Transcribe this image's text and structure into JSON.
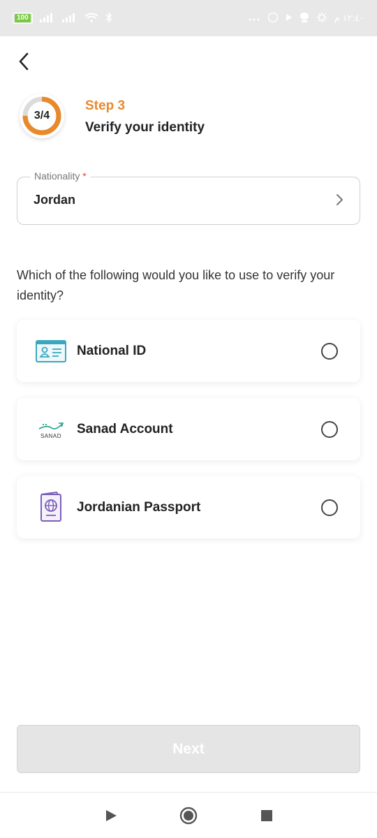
{
  "status_bar": {
    "battery": "100",
    "time": "١٢:٤٠ م"
  },
  "step": {
    "ring_text": "3/4",
    "progress": 0.75,
    "label": "Step 3",
    "title": "Verify your identity",
    "accent_color": "#e8892c"
  },
  "nationality": {
    "label": "Nationality",
    "required_mark": "*",
    "value": "Jordan"
  },
  "question": "Which of the following would you like to use to verify your identity?",
  "options": [
    {
      "label": "National ID",
      "icon": "id-card-icon",
      "selected": false
    },
    {
      "label": "Sanad Account",
      "icon": "sanad-logo",
      "logo_text": "SANAD",
      "selected": false
    },
    {
      "label": "Jordanian Passport",
      "icon": "passport-icon",
      "selected": false
    }
  ],
  "next_button": {
    "label": "Next",
    "enabled": false
  }
}
